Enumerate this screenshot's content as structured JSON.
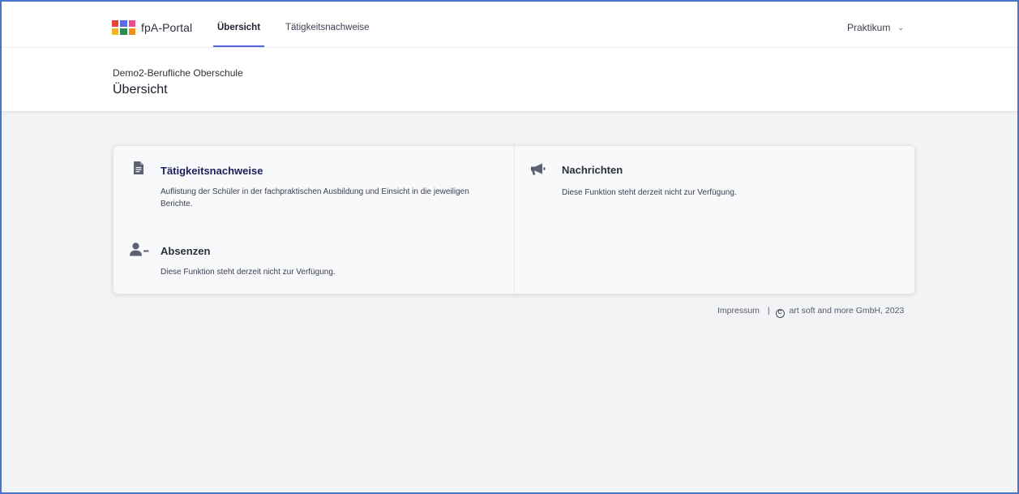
{
  "nav": {
    "brand": "fpA-Portal",
    "tabs": [
      {
        "label": "Übersicht",
        "active": true
      },
      {
        "label": "Tätigkeitsnachweise",
        "active": false
      }
    ],
    "context_menu": "Praktikum",
    "logo_colors": [
      "#e8423d",
      "#5b6ae6",
      "#e94d8c",
      "#f4b51d",
      "#2d8b4e",
      "#f28f1d"
    ]
  },
  "header": {
    "organization": "Demo2-Berufliche Oberschule",
    "title": "Übersicht"
  },
  "cards": {
    "taetigkeit": {
      "title": "Tätigkeitsnachweise",
      "description": "Auflistung der Schüler in der fachpraktischen Ausbildung und Einsicht in die jeweiligen Berichte.",
      "icon": "document-icon"
    },
    "absenzen": {
      "title": "Absenzen",
      "description": "Diese Funktion steht derzeit nicht zur Verfügung.",
      "icon": "user-minus-icon"
    },
    "nachrichten": {
      "title": "Nachrichten",
      "description": "Diese Funktion steht derzeit nicht zur Verfügung.",
      "icon": "megaphone-icon"
    }
  },
  "footer": {
    "impressum": "Impressum",
    "separator": "|",
    "copyright": "art soft and more GmbH, 2023"
  },
  "colors": {
    "accent": "#5a63d8",
    "link_title": "#1a1f5c",
    "frame_border": "#4a74c9"
  }
}
